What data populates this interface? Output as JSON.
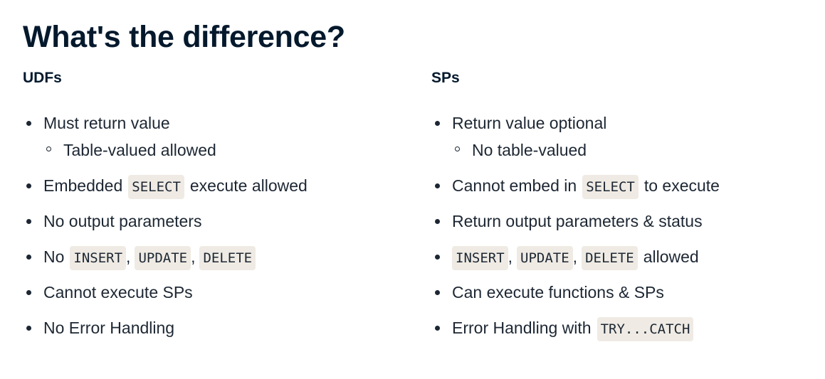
{
  "title": "What's the difference?",
  "left": {
    "heading": "UDFs",
    "items": [
      {
        "text": "Must return value",
        "sub": "Table-valued allowed"
      },
      {
        "before": "Embedded",
        "code": "SELECT",
        "after": "execute allowed"
      },
      {
        "text": "No output parameters"
      },
      {
        "before": "No",
        "codes": [
          "INSERT",
          "UPDATE",
          "DELETE"
        ],
        "sep": ","
      },
      {
        "text": "Cannot execute SPs"
      },
      {
        "text": "No Error Handling"
      }
    ]
  },
  "right": {
    "heading": "SPs",
    "items": [
      {
        "text": "Return value optional",
        "sub": "No table-valued"
      },
      {
        "before": "Cannot embed in",
        "code": "SELECT",
        "after": "to execute"
      },
      {
        "text": "Return output parameters & status"
      },
      {
        "codes": [
          "INSERT",
          "UPDATE",
          "DELETE"
        ],
        "sep": ",",
        "after": "allowed"
      },
      {
        "text": "Can execute functions & SPs"
      },
      {
        "before": "Error Handling with",
        "code": "TRY...CATCH"
      }
    ]
  },
  "colors": {
    "heading": "#05192d",
    "text": "#1d2733",
    "code_bg": "#efebe4"
  }
}
